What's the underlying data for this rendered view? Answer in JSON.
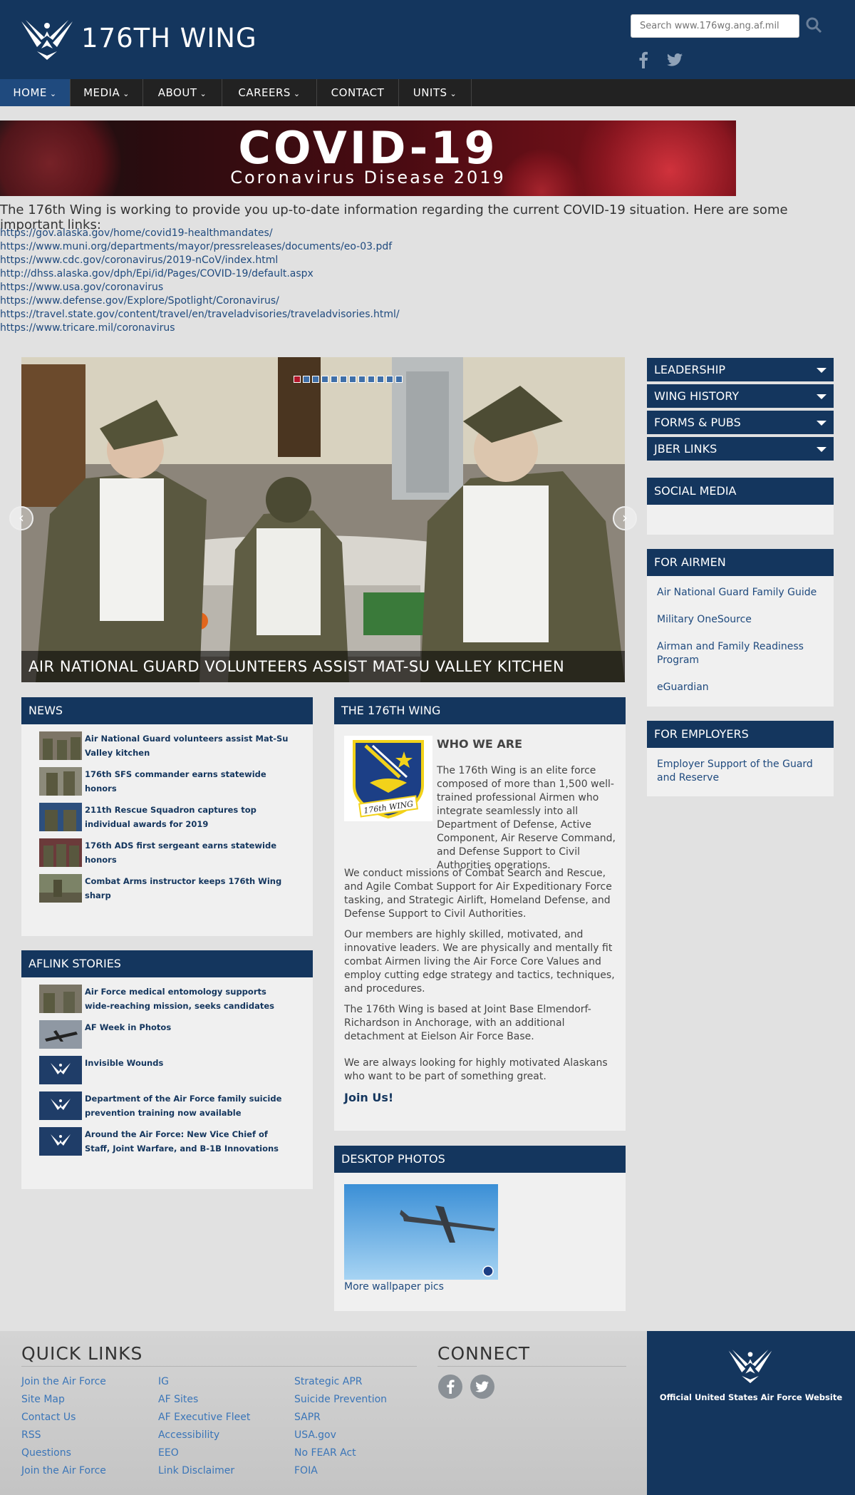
{
  "header": {
    "title": "176TH WING",
    "search_placeholder": "Search www.176wg.ang.af.mil"
  },
  "nav": [
    {
      "label": "HOME"
    },
    {
      "label": "MEDIA"
    },
    {
      "label": "ABOUT"
    },
    {
      "label": "CAREERS"
    },
    {
      "label": "CONTACT"
    },
    {
      "label": "UNITS"
    }
  ],
  "covid": {
    "banner_title": "COVID-19",
    "banner_subtitle": "Coronavirus Disease 2019",
    "intro": "The 176th Wing is working to provide you up-to-date information regarding the current COVID-19 situation. Here are some important links:",
    "links": [
      "https://gov.alaska.gov/home/covid19-healthmandates/",
      "https://www.muni.org/departments/mayor/pressreleases/documents/eo-03.pdf",
      "https://www.cdc.gov/coronavirus/2019-nCoV/index.html",
      "http://dhss.alaska.gov/dph/Epi/id/Pages/COVID-19/default.aspx",
      "https://www.usa.gov/coronavirus",
      "https://www.defense.gov/Explore/Spotlight/Coronavirus/",
      "https://travel.state.gov/content/travel/en/traveladvisories/traveladvisories.html/",
      "https://www.tricare.mil/coronavirus"
    ]
  },
  "carousel": {
    "caption": "AIR NATIONAL GUARD VOLUNTEERS ASSIST MAT-SU VALLEY KITCHEN",
    "slide_count": 12,
    "active_slide": 1
  },
  "news": {
    "heading": "NEWS",
    "items": [
      {
        "title": "Air National Guard volunteers assist Mat-Su Valley kitchen"
      },
      {
        "title": "176th SFS commander earns statewide honors"
      },
      {
        "title": "211th Rescue Squadron captures top individual awards for 2019"
      },
      {
        "title": "176th ADS first sergeant earns statewide honors"
      },
      {
        "title": "Combat Arms instructor keeps 176th Wing sharp"
      }
    ]
  },
  "aflink": {
    "heading": "AFLINK STORIES",
    "items": [
      {
        "title": "Air Force medical entomology supports wide-reaching mission, seeks candidates"
      },
      {
        "title": "AF Week in Photos"
      },
      {
        "title": "Invisible Wounds"
      },
      {
        "title": "Department of the Air Force family suicide prevention training now available"
      },
      {
        "title": "Around the Air Force: New Vice Chief of Staff, Joint Warfare, and B-1B Innovations"
      }
    ]
  },
  "wing": {
    "heading": "THE 176TH WING",
    "subheading": "WHO WE ARE",
    "emblem_text": "176th WING",
    "paragraphs": [
      "The 176th Wing is an elite force composed of more than 1,500 well-trained professional Airmen who integrate seamlessly into all Department of Defense, Active Component, Air Reserve Command, and Defense Support to Civil Authorities operations.",
      "We conduct missions of Combat Search and Rescue, and Agile Combat Support for Air Expeditionary Force tasking, and Strategic Airlift, Homeland Defense, and Defense Support to Civil Authorities.",
      "Our members are highly skilled, motivated, and innovative leaders. We are physically and mentally fit combat Airmen living the Air Force Core Values and employ cutting edge strategy and tactics, techniques, and procedures.",
      "The 176th Wing is based at Joint Base Elmendorf-Richardson in Anchorage, with an additional detachment at Eielson Air Force Base.",
      "We are always looking for highly motivated Alaskans who want to be part of something great."
    ],
    "cta": "Join Us!"
  },
  "desktop_photos": {
    "heading": "DESKTOP PHOTOS",
    "link": "More wallpaper pics"
  },
  "sidebar": {
    "menus": [
      "LEADERSHIP",
      "WING HISTORY",
      "FORMS & PUBS",
      "JBER LINKS"
    ],
    "social_heading": "SOCIAL MEDIA",
    "airmen_heading": "FOR AIRMEN",
    "airmen_links": [
      "Air National Guard Family Guide",
      "Military OneSource",
      "Airman and Family Readiness Program",
      "eGuardian"
    ],
    "employers_heading": "FOR EMPLOYERS",
    "employers_links": [
      "Employer Support of the Guard and Reserve"
    ]
  },
  "footer": {
    "quick_links_heading": "QUICK LINKS",
    "connect_heading": "CONNECT",
    "col1": [
      "Join the Air Force",
      "Site Map",
      "Contact Us",
      "RSS",
      "Questions",
      "Join the Air Force"
    ],
    "col2": [
      "IG",
      "AF Sites",
      "AF Executive Fleet",
      "Accessibility",
      "EEO",
      "Link Disclaimer"
    ],
    "col3": [
      "Strategic APR",
      "Suicide Prevention",
      "SAPR",
      "USA.gov",
      "No FEAR Act",
      "FOIA"
    ],
    "af_site_label": "Official United States Air Force Website"
  },
  "colors": {
    "navy": "#14365e",
    "link": "#1f4a7e",
    "nav_bg": "#222222",
    "footer_link": "#3a75b8"
  }
}
